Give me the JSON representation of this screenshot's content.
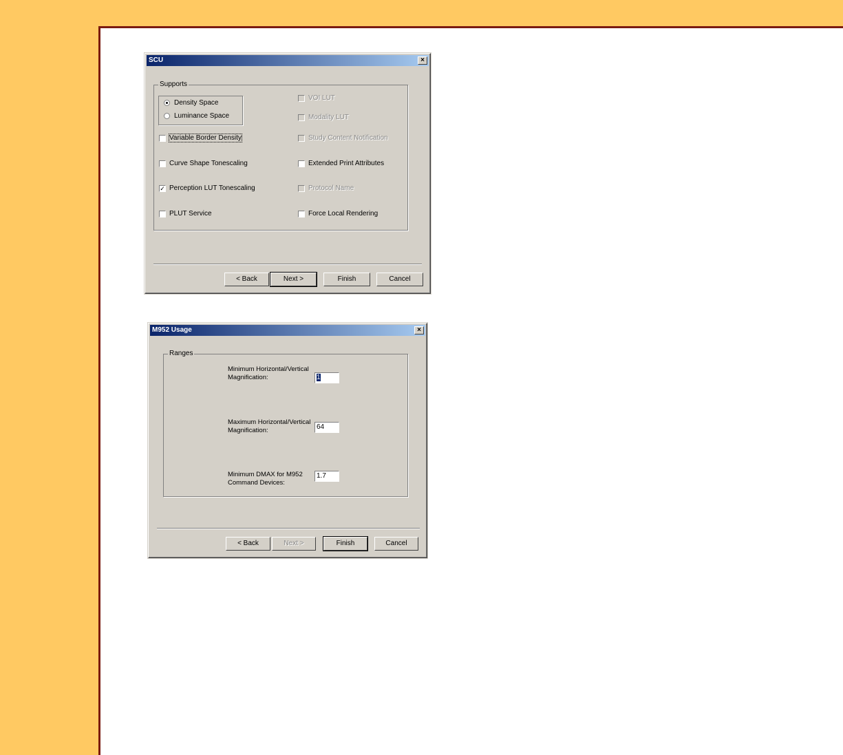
{
  "scu_dialog": {
    "title": "SCU",
    "group_label": "Supports",
    "radio_options": [
      {
        "label": "Density Space",
        "selected": true
      },
      {
        "label": "Luminance Space",
        "selected": false
      }
    ],
    "left_checks": [
      {
        "label": "Variable Border Density",
        "checked": false
      },
      {
        "label": "Curve Shape Tonescaling",
        "checked": false
      },
      {
        "label": "Perception LUT Tonescaling",
        "checked": true
      },
      {
        "label": "PLUT Service",
        "checked": false
      }
    ],
    "right_checks": [
      {
        "label": "VOI LUT",
        "checked": false,
        "disabled": true
      },
      {
        "label": "Modality LUT",
        "checked": false,
        "disabled": true
      },
      {
        "label": "Study Content Notification",
        "checked": false,
        "disabled": true
      },
      {
        "label": "Extended Print Attributes",
        "checked": false,
        "disabled": false
      },
      {
        "label": "Protocol Name",
        "checked": false,
        "disabled": true
      },
      {
        "label": "Force Local Rendering",
        "checked": false,
        "disabled": false
      }
    ],
    "buttons": {
      "back": "< Back",
      "next": "Next >",
      "finish": "Finish",
      "cancel": "Cancel"
    }
  },
  "m952_dialog": {
    "title": "M952 Usage",
    "group_label": "Ranges",
    "fields": [
      {
        "label_line1": "Minimum Horizontal/Vertical",
        "label_line2": "Magnification:",
        "value": "1"
      },
      {
        "label_line1": "Maximum Horizontal/Vertical",
        "label_line2": "Magnification:",
        "value": "64"
      },
      {
        "label_line1": "Minimum DMAX for M952",
        "label_line2": "Command Devices:",
        "value": "1.7"
      }
    ],
    "buttons": {
      "back": "< Back",
      "next": "Next >",
      "finish": "Finish",
      "cancel": "Cancel"
    }
  },
  "icons": {
    "close": "close-icon"
  },
  "colors": {
    "page_bg": "#ffc962",
    "panel_border": "#7a1a10",
    "title_start": "#0a246a",
    "title_end": "#a6caf0",
    "dialog_face": "#d4d0c8"
  }
}
